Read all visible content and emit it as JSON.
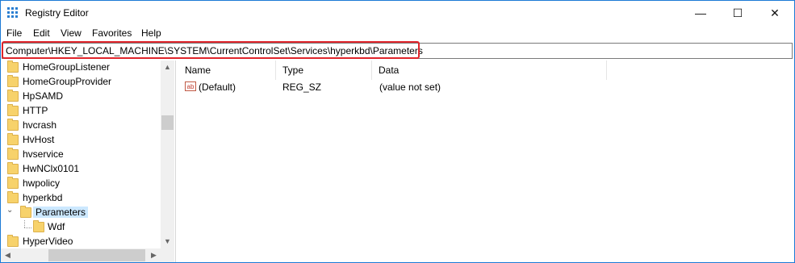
{
  "window": {
    "title": "Registry Editor"
  },
  "controls": {
    "minimize": "—",
    "maximize": "☐",
    "close": "✕"
  },
  "menu": [
    "File",
    "Edit",
    "View",
    "Favorites",
    "Help"
  ],
  "address": {
    "path": "Computer\\HKEY_LOCAL_MACHINE\\SYSTEM\\CurrentControlSet\\Services\\hyperkbd\\Parameters"
  },
  "tree": {
    "items": [
      {
        "label": "HomeGroupListener"
      },
      {
        "label": "HomeGroupProvider"
      },
      {
        "label": "HpSAMD"
      },
      {
        "label": "HTTP"
      },
      {
        "label": "hvcrash"
      },
      {
        "label": "HvHost"
      },
      {
        "label": "hvservice"
      },
      {
        "label": "HwNClx0101"
      },
      {
        "label": "hwpolicy"
      },
      {
        "label": "hyperkbd"
      },
      {
        "label": "Parameters",
        "selected": true,
        "expanded": true
      },
      {
        "label": "Wdf"
      },
      {
        "label": "HyperVideo"
      }
    ]
  },
  "list": {
    "columns": [
      "Name",
      "Type",
      "Data"
    ],
    "rows": [
      {
        "icon": "ab",
        "name": "(Default)",
        "type": "REG_SZ",
        "data": "(value not set)"
      }
    ]
  },
  "accent": {
    "highlight": "#e0252b",
    "selection": "#cce8ff"
  }
}
